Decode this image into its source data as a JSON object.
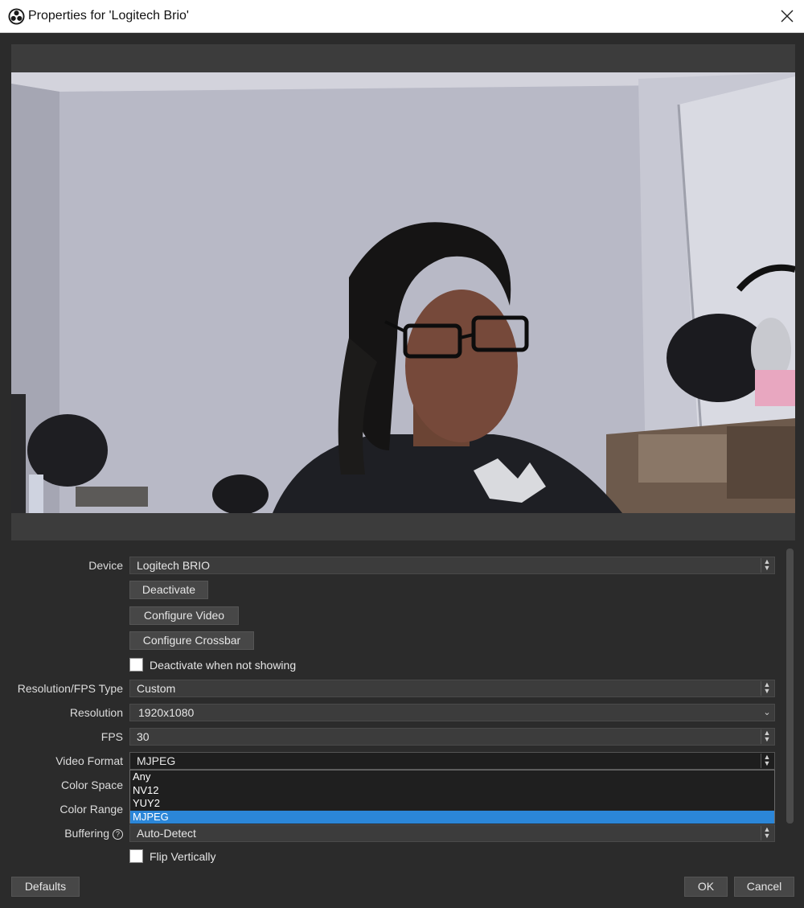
{
  "window": {
    "title": "Properties for 'Logitech Brio'",
    "app_icon": "obs-icon",
    "close_icon": "close-icon"
  },
  "preview": {
    "description_icon": "webcam-preview-image"
  },
  "form": {
    "device": {
      "label": "Device",
      "value": "Logitech BRIO"
    },
    "deactivate_button": "Deactivate",
    "configure_video_button": "Configure Video",
    "configure_crossbar_button": "Configure Crossbar",
    "deactivate_when_not_showing": {
      "label": "Deactivate when not showing",
      "checked": false
    },
    "resolution_fps_type": {
      "label": "Resolution/FPS Type",
      "value": "Custom"
    },
    "resolution": {
      "label": "Resolution",
      "value": "1920x1080"
    },
    "fps": {
      "label": "FPS",
      "value": "30"
    },
    "video_format": {
      "label": "Video Format",
      "value": "MJPEG",
      "options": [
        "Any",
        "NV12",
        "YUY2",
        "MJPEG"
      ],
      "selected_index": 3
    },
    "color_space": {
      "label": "Color Space"
    },
    "color_range": {
      "label": "Color Range"
    },
    "buffering": {
      "label": "Buffering",
      "value": "Auto-Detect",
      "help_icon": "question-circle-icon"
    },
    "flip_vertically": {
      "label": "Flip Vertically",
      "checked": false
    }
  },
  "footer": {
    "defaults_button": "Defaults",
    "ok_button": "OK",
    "cancel_button": "Cancel"
  },
  "colors": {
    "background": "#2b2b2b",
    "field": "#3c3c3c",
    "selection": "#2b86d8"
  }
}
